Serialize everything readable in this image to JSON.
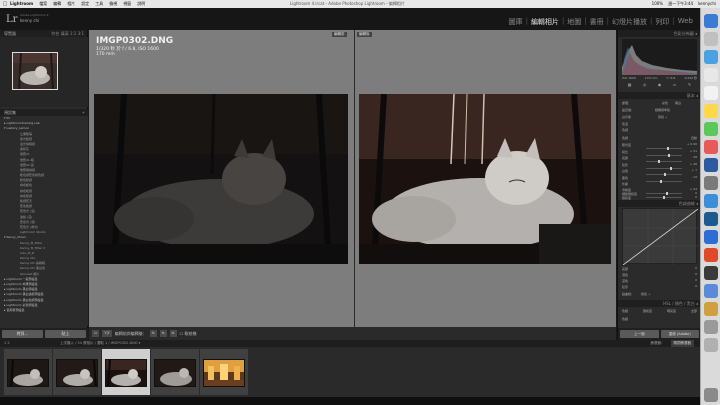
{
  "macbar": {
    "app": "Lightroom",
    "menus": [
      "檔案",
      "編輯",
      "相片",
      "設定",
      "工具",
      "檢視",
      "視窗",
      "說明"
    ],
    "window_title": "Lightroom 4.lrcat - Adobe Photoshop Lightroom - 編輯相片",
    "status": [
      "100%",
      "週一下午3:44",
      "kennychi"
    ]
  },
  "identity": {
    "logo": "Lr",
    "line1": "Adobe Lightroom 4",
    "line2": "kenny chi"
  },
  "modules": [
    "圖庫",
    "編輯相片",
    "地圖",
    "書冊",
    "幻燈片播放",
    "列印",
    "Web"
  ],
  "active_module": "編輯相片",
  "left_panel": {
    "navigator_title": "導覽器",
    "navigator_zoom": [
      "符合",
      "填滿",
      "1:1",
      "3:1"
    ],
    "presets_title": "預設集",
    "preset_rows": [
      {
        "label": "▾ IN",
        "type": "folder"
      },
      {
        "label": "▸ Lightroomtraining Lab",
        "type": "folder"
      },
      {
        "label": "▾ Lastory_Lemon",
        "type": "folder"
      },
      {
        "label": "立果暖陽",
        "type": "child"
      },
      {
        "label": "柔光暖調",
        "type": "child"
      },
      {
        "label": "電光綠暗調",
        "type": "child"
      },
      {
        "label": "柔和灰",
        "type": "child"
      },
      {
        "label": "懷舊01",
        "type": "child"
      },
      {
        "label": "懷舊01-暗",
        "type": "child"
      },
      {
        "label": "懷舊02-亮",
        "type": "child"
      },
      {
        "label": "懷舊暗綠調",
        "type": "child"
      },
      {
        "label": "暖色調藍色暗色調",
        "type": "child"
      },
      {
        "label": "暖色暖調",
        "type": "child"
      },
      {
        "label": "綠色暖色",
        "type": "child"
      },
      {
        "label": "綠色暖調",
        "type": "child"
      },
      {
        "label": "綠色暖調",
        "type": "child"
      },
      {
        "label": "暖調藍天",
        "type": "child"
      },
      {
        "label": "藍色暖調",
        "type": "child"
      },
      {
        "label": "藍色光 (深)",
        "type": "child"
      },
      {
        "label": "濾鏡 (深)",
        "type": "child"
      },
      {
        "label": "藍色光 (淺)",
        "type": "child"
      },
      {
        "label": "藍色光 (黃光)",
        "type": "child"
      },
      {
        "label": "Lightroom Studio",
        "type": "child"
      },
      {
        "label": "▾ Kenny_Chien",
        "type": "folder"
      },
      {
        "label": "Kenny_M_Filter",
        "type": "child"
      },
      {
        "label": "Kenny_M_Filter 2",
        "type": "child"
      },
      {
        "label": "Ivan_M_R",
        "type": "child"
      },
      {
        "label": "Kenny Chi-",
        "type": "child"
      },
      {
        "label": "Kenny Chi 編輯暗",
        "type": "child"
      },
      {
        "label": "Kenny Chi 黑白色",
        "type": "child"
      },
      {
        "label": "Glinvest 相片",
        "type": "child"
      },
      {
        "label": "▸ Lightroom 一般預設集",
        "type": "folder"
      },
      {
        "label": "▸ Lightroom 效果預設集",
        "type": "folder"
      },
      {
        "label": "▸ Lightroom 黑白預設集",
        "type": "folder"
      },
      {
        "label": "▸ Lightroom 黑白濾鏡預設集",
        "type": "folder"
      },
      {
        "label": "▸ Lightroom 黑白色調預設集",
        "type": "folder"
      },
      {
        "label": "▸ Lightroom 彩色預設集",
        "type": "folder"
      },
      {
        "label": "▸ 使用者預設集",
        "type": "folder"
      }
    ],
    "copy_button": "拷貝...",
    "paste_button": "貼上"
  },
  "center": {
    "filename": "IMGP0302.DNG",
    "exposure_line": "1/320 秒 於 f / 6.8, ISO 1600",
    "focal_line": "170 mm",
    "before_tag": "編輯前",
    "after_tag": "編輯後"
  },
  "toolbar": {
    "view_modes": [
      "▭",
      "Y|Y"
    ],
    "label": "編輯前與編輯後：",
    "swap_icons": [
      "⇆",
      "⇆",
      "⇆"
    ],
    "soft_proof": "軟校樣"
  },
  "right_panel": {
    "histogram_title": "色彩分佈圖 ◂",
    "histo_readouts": [
      "ISO 1600",
      "170 mm",
      "f / 6.8",
      "1/320 秒"
    ],
    "basic_title": "基本 ◂",
    "treatment_label": "處理：",
    "treatment_options": [
      "彩色",
      "黑白"
    ],
    "profile_label": "設定檔：",
    "profile_value": "相機標準版",
    "wb_label": "白平衡",
    "wb_value": "原樣 ÷",
    "temp_label": "色溫",
    "tint_label": "色調",
    "tone_label": "色調",
    "auto_label": "自動",
    "basic_rows": [
      {
        "label": "曝光度",
        "value": "+ 0.90",
        "pos": 0.62
      },
      {
        "label": "對比",
        "value": "+ 31",
        "pos": 0.64
      },
      {
        "label": "亮部",
        "value": "- 48",
        "pos": 0.34
      },
      {
        "label": "陰影",
        "value": "+ 46",
        "pos": 0.71
      },
      {
        "label": "白色",
        "value": "+ 7",
        "pos": 0.54
      },
      {
        "label": "黑色",
        "value": "- 19",
        "pos": 0.42
      }
    ],
    "presence_label": "外觀",
    "presence_rows": [
      {
        "label": "清晰度",
        "value": "+ 24",
        "pos": 0.6
      },
      {
        "label": "細節飽和度",
        "value": "0",
        "pos": 0.5
      },
      {
        "label": "飽和度",
        "value": "0",
        "pos": 0.5
      }
    ],
    "curve_title": "色調曲線 ◂",
    "curve_rows": [
      {
        "label": "亮部",
        "value": "0"
      },
      {
        "label": "淺色",
        "value": "0"
      },
      {
        "label": "深色",
        "value": "0"
      },
      {
        "label": "陰影",
        "value": "0"
      }
    ],
    "point_curve_label": "點曲線：",
    "point_curve_value": "線性 ÷",
    "hsl_title": "HSL / 顏色 / 黑白 ◂",
    "hsl_tabs": [
      "色相",
      "飽和度",
      "明亮度",
      "全部"
    ],
    "hsl_adjust_label": "色相",
    "prev_button": "上一個",
    "reset_button": "重設 (Adobe)"
  },
  "filmstrip": {
    "nav_left": "1  2",
    "path": "上次匯入 / 34 張相片 / 選取 1 / IMGP0302.DNG ▾",
    "filter_label": "篩選器：",
    "filter_value": "關閉篩選器"
  },
  "colors": {
    "bg_dark": "#1a1a1a",
    "panel": "#2b2b2b",
    "center_bg": "#7d7d7d",
    "active_text": "#e6e6e6"
  }
}
